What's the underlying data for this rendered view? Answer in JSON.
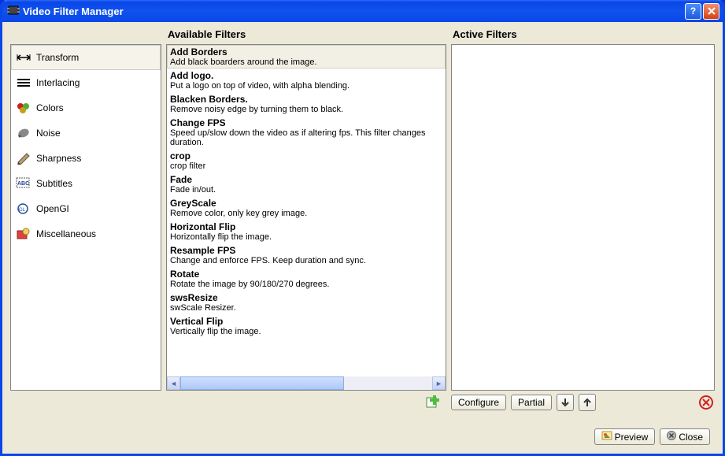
{
  "window": {
    "title": "Video Filter Manager"
  },
  "headings": {
    "available": "Available Filters",
    "active": "Active Filters"
  },
  "categories": [
    {
      "label": "Transform",
      "icon": "arrows-h"
    },
    {
      "label": "Interlacing",
      "icon": "lines"
    },
    {
      "label": "Colors",
      "icon": "palette"
    },
    {
      "label": "Noise",
      "icon": "noise"
    },
    {
      "label": "Sharpness",
      "icon": "pencil"
    },
    {
      "label": "Subtitles",
      "icon": "abc"
    },
    {
      "label": "OpenGl",
      "icon": "opengl"
    },
    {
      "label": "Miscellaneous",
      "icon": "misc"
    }
  ],
  "selectedCategory": 0,
  "filters": [
    {
      "name": "Add Borders",
      "desc": "Add black boarders around the image."
    },
    {
      "name": "Add logo.",
      "desc": "Put a logo on top of video, with alpha blending."
    },
    {
      "name": "Blacken Borders.",
      "desc": "Remove noisy edge by turning them to black."
    },
    {
      "name": "Change FPS",
      "desc": "Speed up/slow down the video as if altering fps. This filter changes duration."
    },
    {
      "name": "crop",
      "desc": "crop filter"
    },
    {
      "name": "Fade",
      "desc": "Fade in/out."
    },
    {
      "name": "GreyScale",
      "desc": "Remove color, only key grey image."
    },
    {
      "name": "Horizontal Flip",
      "desc": "Horizontally flip the image."
    },
    {
      "name": "Resample FPS",
      "desc": "Change and enforce FPS. Keep duration and sync."
    },
    {
      "name": "Rotate",
      "desc": "Rotate the image by 90/180/270 degrees."
    },
    {
      "name": "swsResize",
      "desc": "swScale Resizer."
    },
    {
      "name": "Vertical Flip",
      "desc": "Vertically flip the image."
    }
  ],
  "selectedFilter": 0,
  "buttons": {
    "configure": "Configure",
    "partial": "Partial",
    "preview": "Preview",
    "close": "Close"
  }
}
